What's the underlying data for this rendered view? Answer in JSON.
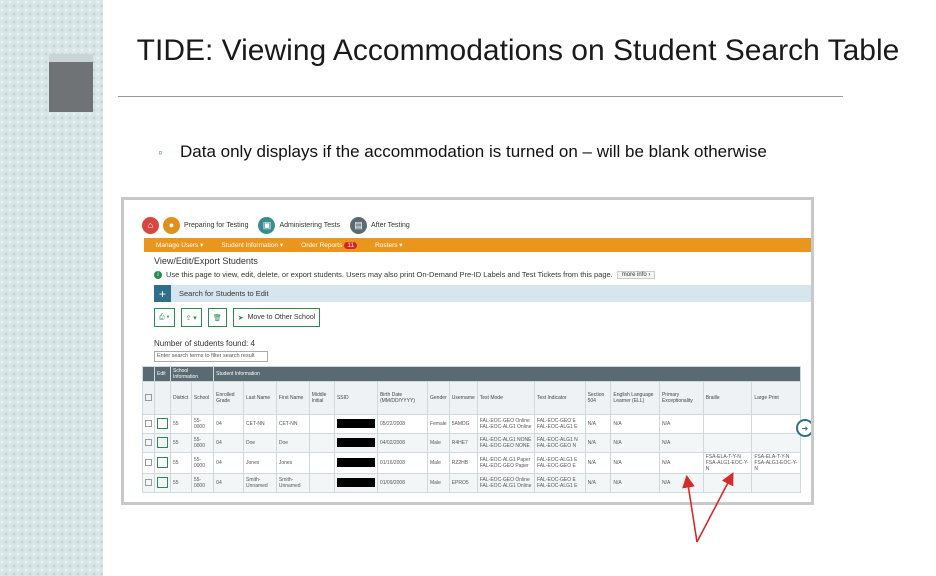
{
  "slide": {
    "title": "TIDE: Viewing Accommodations on Student Search Table",
    "bullet_mark": "◦",
    "bullet": "Data only displays if the accommodation is turned on – will be blank otherwise"
  },
  "app": {
    "nav": [
      {
        "label": "Preparing for Testing",
        "icon": "person-icon",
        "color": "#e0911c"
      },
      {
        "label": "Administering Tests",
        "icon": "monitor-icon",
        "color": "#3a8d8f"
      },
      {
        "label": "After Testing",
        "icon": "report-icon",
        "color": "#5b6b73"
      }
    ],
    "menu": [
      "Manage Users ▾",
      "Student Information ▾",
      "Order Reports",
      "Rosters ▾"
    ],
    "order_reports_badge": "11",
    "page_heading": "View/Edit/Export Students",
    "info_text": "Use this page to view, edit, delete, or export students. Users may also print On-Demand Pre-ID Labels and Test Tickets from this page.",
    "more_info": "more info ›",
    "search_section": "Search for Students to Edit",
    "move_button": "Move to Other School",
    "count_text": "Number of students found: 4",
    "filter_placeholder": "Enter search terms to filter search result",
    "group_headers": [
      "Edit",
      "School Information",
      "Student Information"
    ],
    "columns": [
      "District",
      "School",
      "Enrolled Grade",
      "Last Name",
      "First Name",
      "Middle Initial",
      "SSID",
      "Birth Date (MM/DD/YYYY)",
      "Gender",
      "Username",
      "Test Mode",
      "Test Indicator",
      "Section 504",
      "English Language Learner (ELL)",
      "Primary Exceptionality",
      "Braille",
      "Large Print"
    ],
    "rows": [
      [
        "55",
        "55-0000",
        "04",
        "CET-NN",
        "CET-NN",
        "",
        "",
        "05/22/2008",
        "Female",
        "5AMDG",
        "FAL-EOC-GEO Online FAL-EOC-ALG1 Online",
        "FAL-EOC-GEO E FAL-EOC-ALG1 E",
        "N/A",
        "N/A",
        "N/A",
        "",
        ""
      ],
      [
        "55",
        "55-0000",
        "04",
        "Doe",
        "Doe",
        "",
        "",
        "04/02/2008",
        "Male",
        "R4HE7",
        "FAL-EOC-ALG1 NONE FAL-EOC-GEO NONE",
        "FAL-EOC-ALG1 N FAL-EOC-GEO N",
        "N/A",
        "N/A",
        "N/A",
        "",
        ""
      ],
      [
        "55",
        "55-0000",
        "04",
        "Jones",
        "Jones",
        "",
        "",
        "01/16/2008",
        "Male",
        "RZ2HB",
        "FAL-EOC-ALG1 Paper FAL-EOC-GEO Paper",
        "FAL-EOC-ALG1 E FAL-EOC-GEO E",
        "N/A",
        "N/A",
        "N/A",
        "FSA-ELA-T-Y-N FSA-ALG1-EOC-Y-N",
        "FSA-ELA-T-Y-N FSA-ALG1-EOC-Y-N"
      ],
      [
        "55",
        "55-0000",
        "04",
        "Smith-Unnamed",
        "Smith-Unnamed",
        "",
        "",
        "01/09/2008",
        "Male",
        "EPRO5",
        "FAL-EOC-GEO Online FAL-EOC-ALG1 Online",
        "FAL-EOC-GEO E FAL-EOC-ALG1 E",
        "N/A",
        "N/A",
        "N/A",
        "",
        ""
      ]
    ]
  }
}
